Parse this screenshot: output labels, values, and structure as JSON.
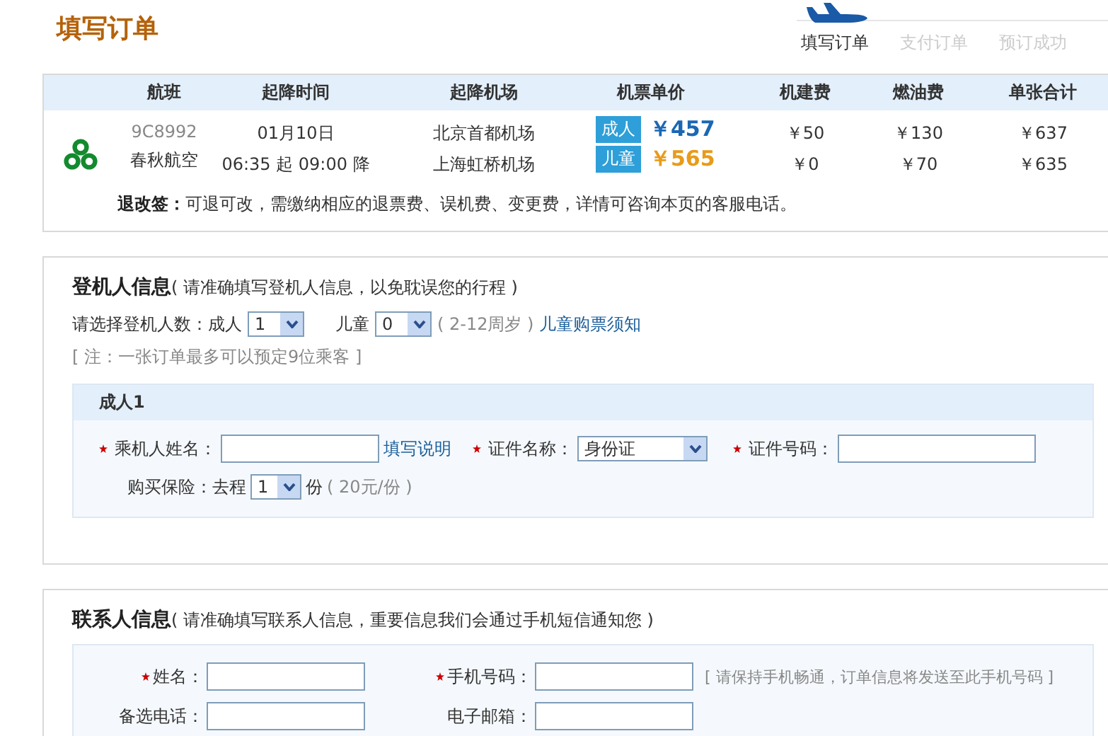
{
  "title": "填写订单",
  "steps": [
    {
      "label": "填写订单",
      "selected": true
    },
    {
      "label": "支付订单",
      "selected": false
    },
    {
      "label": "预订成功",
      "selected": false
    }
  ],
  "flight": {
    "columns": [
      "航班",
      "起降时间",
      "起降机场",
      "机票单价",
      "机建费",
      "燃油费",
      "单张合计"
    ],
    "flight_no": "9C8992",
    "airline": "春秋航空",
    "date": "01月10日",
    "time_dep": "06:35",
    "dep_word": "起",
    "time_arr": "09:00",
    "arr_word": "降",
    "airport_dep": "北京首都机场",
    "airport_arr": "上海虹桥机场",
    "fares": [
      {
        "kind": "adult",
        "tag": "成人",
        "price": "￥457",
        "tax": "￥50",
        "fuel": "￥130",
        "total": "￥637"
      },
      {
        "kind": "child",
        "tag": "儿童",
        "price": "￥565",
        "tax": "￥0",
        "fuel": "￥70",
        "total": "￥635"
      }
    ],
    "refund_label": "退改签：",
    "refund_text": "可退可改，需缴纳相应的退票费、误机费、变更费，详情可咨询本页的客服电话。"
  },
  "passengers": {
    "heading": "登机人信息",
    "hint": "( 请准确填写登机人信息，以免耽误您的行程 )",
    "count_label": "请选择登机人数：成人",
    "adult_count": "1",
    "child_label": "儿童",
    "child_count": "0",
    "age_note": "( 2-12周岁 )",
    "child_link": "儿童购票须知",
    "note": "[ 注：一张订单最多可以预定9位乘客 ]",
    "panel_title": "成人1",
    "fields": [
      {
        "label": "乘机人姓名：",
        "required": true,
        "kind": "input",
        "link": "填写说明"
      },
      {
        "label": "证件名称：",
        "required": true,
        "kind": "select",
        "value": "身份证"
      },
      {
        "label": "证件号码：",
        "required": true,
        "kind": "input"
      }
    ],
    "insurance_label": "购买保险：去程",
    "insurance_count": "1",
    "insurance_unit": "份",
    "insurance_price": "( 20元/份 )"
  },
  "contact": {
    "heading": "联系人信息",
    "hint": "( 请准确填写联系人信息，重要信息我们会通过手机短信通知您 )",
    "fields": [
      {
        "label": "姓名：",
        "required": true
      },
      {
        "label": "手机号码：",
        "required": true,
        "note": "[ 请保持手机畅通，订单信息将发送至此手机号码 ]"
      },
      {
        "label": "备选电话：",
        "required": false
      },
      {
        "label": "电子邮箱：",
        "required": false
      }
    ]
  }
}
